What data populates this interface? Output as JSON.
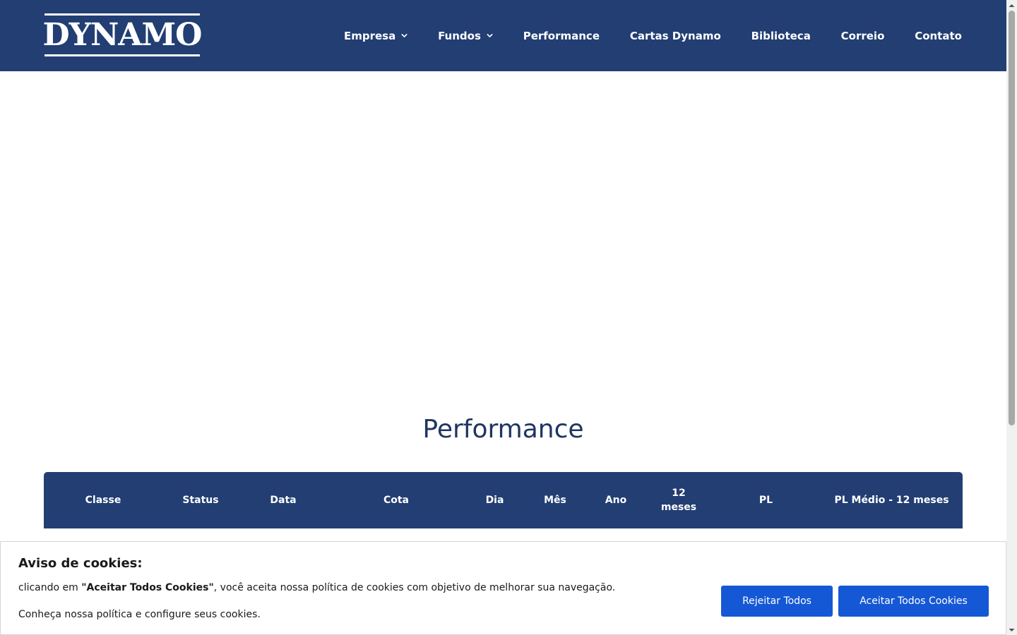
{
  "header": {
    "logo_text": "DYNAMO",
    "background_color": "#223e73",
    "nav": [
      {
        "label": "Empresa",
        "has_dropdown": true
      },
      {
        "label": "Fundos",
        "has_dropdown": true
      },
      {
        "label": "Performance",
        "has_dropdown": false
      },
      {
        "label": "Cartas Dynamo",
        "has_dropdown": false
      },
      {
        "label": "Biblioteca",
        "has_dropdown": false
      },
      {
        "label": "Correio",
        "has_dropdown": false
      },
      {
        "label": "Contato",
        "has_dropdown": false
      }
    ]
  },
  "main": {
    "title": "Performance",
    "table": {
      "columns": [
        {
          "line1": "Classe",
          "line2": ""
        },
        {
          "line1": "Status",
          "line2": ""
        },
        {
          "line1": "Data",
          "line2": ""
        },
        {
          "line1": "Cota",
          "line2": ""
        },
        {
          "line1": "Dia",
          "line2": ""
        },
        {
          "line1": "Mês",
          "line2": ""
        },
        {
          "line1": "Ano",
          "line2": ""
        },
        {
          "line1": "12",
          "line2": "meses"
        },
        {
          "line1": "PL",
          "line2": ""
        },
        {
          "line1": "PL Médio - 12 meses",
          "line2": ""
        }
      ]
    }
  },
  "cookie_banner": {
    "title": "Aviso de cookies:",
    "text1_prefix": "clicando em ",
    "text1_bold": "\"Aceitar Todos Cookies\"",
    "text1_suffix": ", você aceita nossa política de cookies com objetivo de melhorar sua navegação.",
    "text2": "Conheça nossa política e configure seus cookies.",
    "reject_label": "Rejeitar Todos",
    "accept_label": "Aceitar Todos Cookies",
    "button_color": "#1558d6"
  }
}
